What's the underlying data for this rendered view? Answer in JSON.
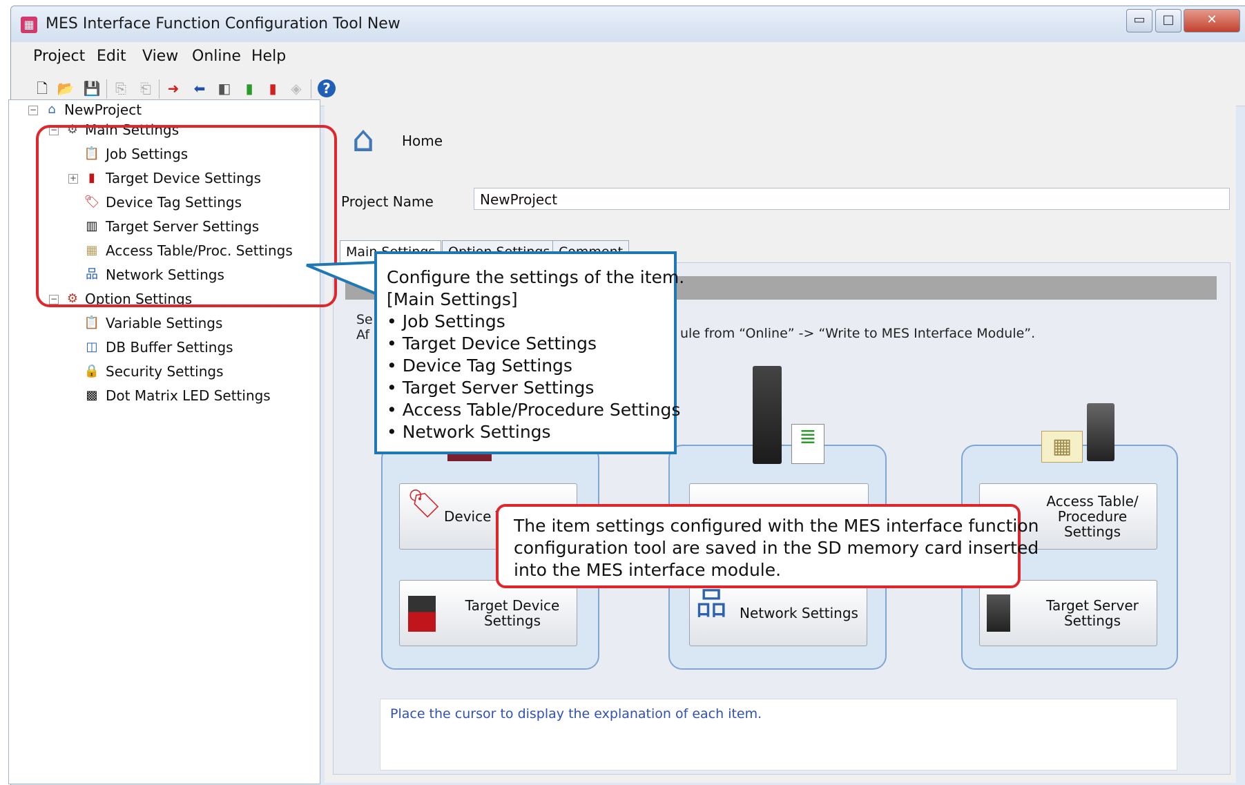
{
  "window": {
    "title": "MES Interface Function Configuration Tool New"
  },
  "menu": {
    "items": [
      "Project",
      "Edit",
      "View",
      "Online",
      "Help"
    ]
  },
  "toolbar": {
    "icons": [
      "new-file-icon",
      "open-folder-icon",
      "save-icon",
      "export-icon",
      "import-icon",
      "write-icon",
      "read-icon",
      "verify-icon",
      "monitor-icon",
      "diagnostic-icon",
      "delete-icon",
      "help-icon"
    ]
  },
  "tree": {
    "root": "NewProject",
    "main_settings": "Main Settings",
    "main_children": [
      "Job Settings",
      "Target Device Settings",
      "Device Tag Settings",
      "Target Server Settings",
      "Access Table/Proc. Settings",
      "Network Settings"
    ],
    "option_settings": "Option Settings",
    "option_children": [
      "Variable Settings",
      "DB Buffer Settings",
      "Security Settings",
      "Dot Matrix LED Settings"
    ]
  },
  "home": {
    "label": "Home"
  },
  "project_name": {
    "label": "Project Name",
    "value": "NewProject"
  },
  "tabs": [
    "Main Settings",
    "Option Settings",
    "Comment"
  ],
  "instruction_partial": {
    "left": "Se\nAf",
    "right": "ule from “Online” -> “Write to MES Interface Module”."
  },
  "buttons": {
    "device_tag": "Device T",
    "target_device": "Target Device Settings",
    "network": "Network Settings",
    "access_table": "Access Table/ Procedure Settings",
    "target_server": "Target Server Settings"
  },
  "explanation": "Place the cursor to display the explanation of each item.",
  "callout_blue": {
    "lines": [
      "Configure the settings of the item.",
      "[Main Settings]",
      "• Job Settings",
      "• Target Device Settings",
      "• Device Tag Settings",
      "• Target Server Settings",
      "• Access Table/Procedure Settings",
      "• Network Settings"
    ]
  },
  "callout_red": {
    "lines": [
      "The item settings configured with the MES interface function",
      "configuration tool are saved in the SD memory card inserted",
      "into the MES interface module."
    ]
  },
  "colors": {
    "highlight_red": "#e0262a",
    "callout_blue": "#1f77b4",
    "help_text_blue": "#3050b8"
  }
}
